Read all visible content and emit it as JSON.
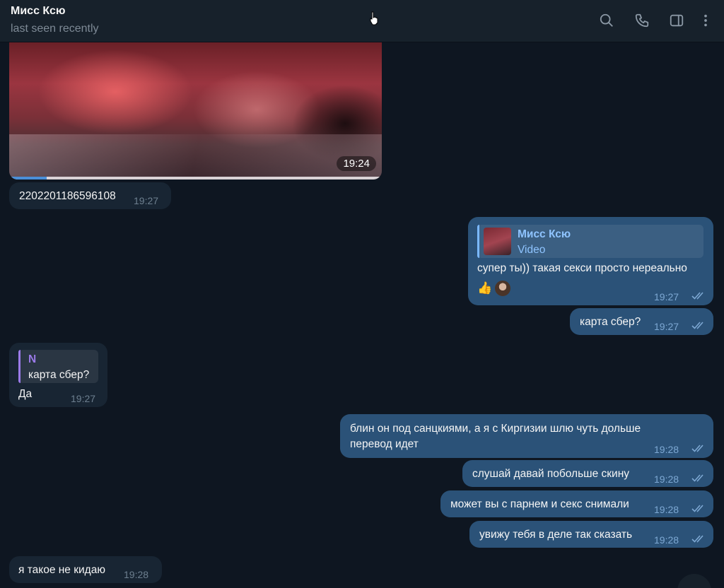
{
  "header": {
    "title": "Мисс Ксю",
    "status": "last seen recently",
    "icons": [
      "search-icon",
      "phone-icon",
      "sidebar-toggle-icon",
      "more-vert-icon"
    ]
  },
  "colors": {
    "background": "#0e1621",
    "header": "#17212b",
    "incoming_bubble": "#182533",
    "outgoing_bubble": "#2b5278",
    "reply_name_out": "#7ab8ff",
    "reply_name_in": "#9b7be9"
  },
  "messages": {
    "video": {
      "time": "19:24",
      "progress": 0.1
    },
    "m1": {
      "text": "2202201186596108",
      "time": "19:27"
    },
    "m2": {
      "reply_name": "Мисс Ксю",
      "reply_sub": "Video",
      "text": "супер ты)) такая секси просто нереально",
      "reaction": "👍",
      "time": "19:27"
    },
    "m3": {
      "text": "карта сбер?",
      "time": "19:27"
    },
    "m4": {
      "reply_name": "N",
      "reply_sub": "карта сбер?",
      "text": "Да",
      "time": "19:27"
    },
    "m5": {
      "line1": "блин он под санцкиями, а я с Киргизии шлю чуть дольше",
      "line2": "перевод идет",
      "time": "19:28"
    },
    "m6": {
      "text": "слушай давай побольше скину",
      "time": "19:28"
    },
    "m7": {
      "text": "может вы с парнем и секс снимали",
      "time": "19:28"
    },
    "m8": {
      "text": "увижу тебя в деле так сказать",
      "time": "19:28"
    },
    "m9": {
      "text": "я такое не кидаю",
      "time": "19:28"
    }
  }
}
